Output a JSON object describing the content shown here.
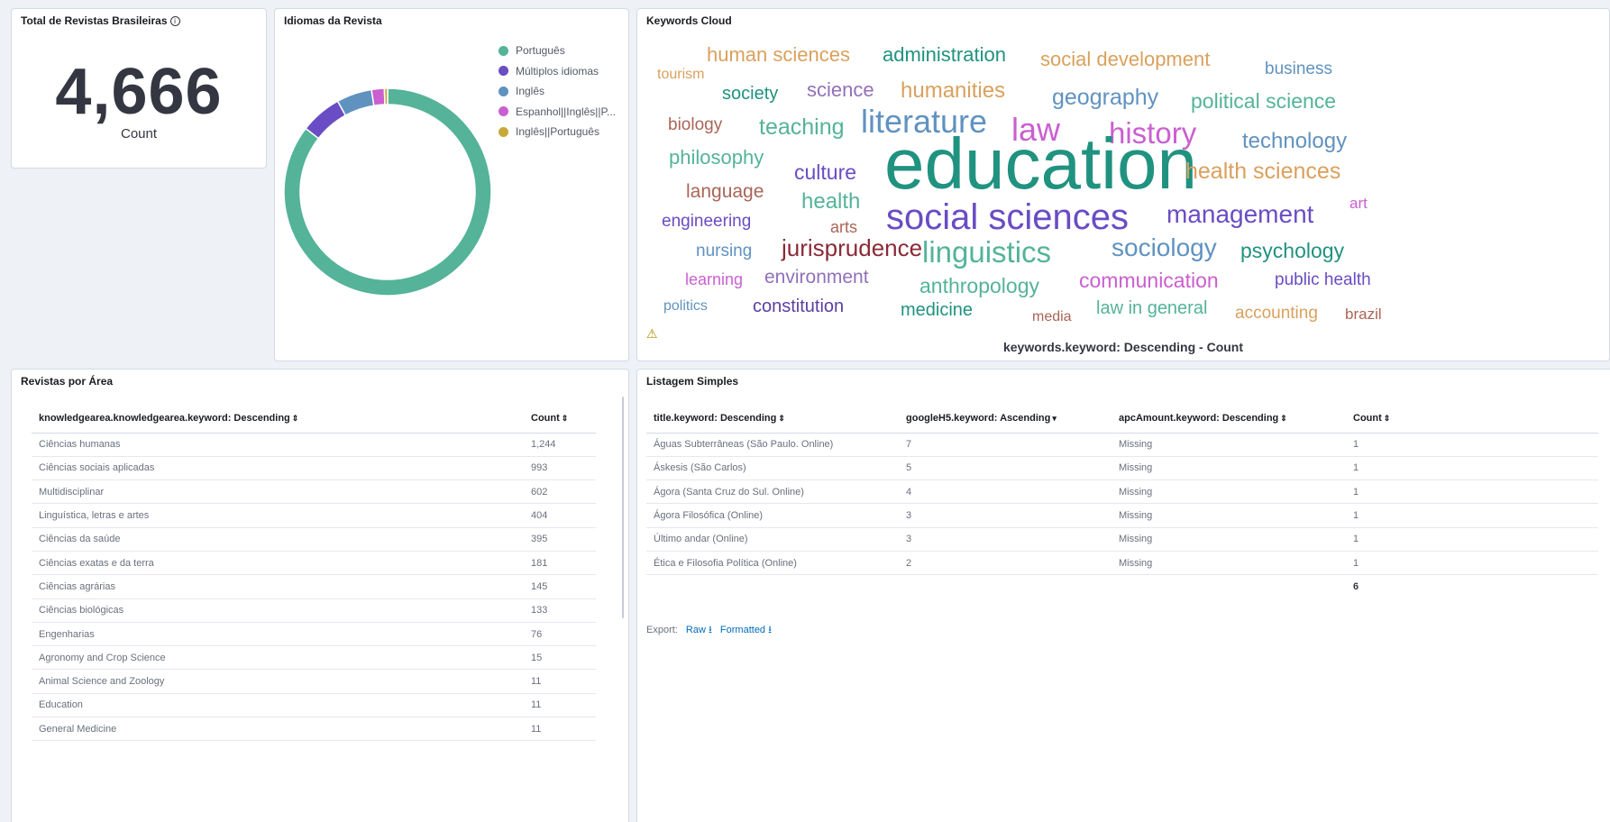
{
  "colors": {
    "green": "#54b399",
    "purple": "#6a4cc4",
    "blue": "#6092c0",
    "pink": "#d36086",
    "gold": "#d6bf57",
    "link": "#006bb8"
  },
  "metric_panel": {
    "title": "Total de Revistas Brasileiras",
    "info_icon": "info-circle-icon",
    "value": "4,666",
    "label": "Count"
  },
  "donut_panel": {
    "title": "Idiomas da Revista",
    "legend": [
      {
        "label": "Português",
        "color": "#54b399"
      },
      {
        "label": "Múltiplos idiomas",
        "color": "#6a4cc4"
      },
      {
        "label": "Inglês",
        "color": "#6092c0"
      },
      {
        "label": "Espanhol||Inglês||P...",
        "color": "#ca5fd0"
      },
      {
        "label": "Inglês||Português",
        "color": "#c7a93a"
      }
    ],
    "chart_data": {
      "type": "pie",
      "donut": true,
      "categories": [
        "Português",
        "Múltiplos idiomas",
        "Inglês",
        "Espanhol||Inglês||P...",
        "Inglês||Português"
      ],
      "values": [
        85.5,
        6.5,
        5.5,
        2.0,
        0.5
      ],
      "unit": "share (%)"
    }
  },
  "cloud_panel": {
    "title": "Keywords Cloud",
    "warning_icon": "warning-triangle-icon",
    "caption": "keywords.keyword: Descending - Count",
    "words": [
      {
        "text": "human sciences",
        "color": "#daa05d",
        "size": 22
      },
      {
        "text": "administration",
        "color": "#209280",
        "size": 22
      },
      {
        "text": "social development",
        "color": "#daa05d",
        "size": 22
      },
      {
        "text": "business",
        "color": "#6092c0",
        "size": 19
      },
      {
        "text": "tourism",
        "color": "#daa05d",
        "size": 16
      },
      {
        "text": "society",
        "color": "#209280",
        "size": 20
      },
      {
        "text": "science",
        "color": "#9170b8",
        "size": 22
      },
      {
        "text": "humanities",
        "color": "#daa05d",
        "size": 24
      },
      {
        "text": "geography",
        "color": "#6092c0",
        "size": 25
      },
      {
        "text": "political science",
        "color": "#54b399",
        "size": 23
      },
      {
        "text": "biology",
        "color": "#aa6556",
        "size": 19
      },
      {
        "text": "teaching",
        "color": "#54b399",
        "size": 25
      },
      {
        "text": "literature",
        "color": "#6092c0",
        "size": 36
      },
      {
        "text": "law",
        "color": "#ca5fd0",
        "size": 36
      },
      {
        "text": "history",
        "color": "#ca5fd0",
        "size": 33
      },
      {
        "text": "technology",
        "color": "#6092c0",
        "size": 24
      },
      {
        "text": "philosophy",
        "color": "#54b399",
        "size": 22
      },
      {
        "text": "culture",
        "color": "#6a4cc4",
        "size": 23
      },
      {
        "text": "education",
        "color": "#209280",
        "size": 80
      },
      {
        "text": "health sciences",
        "color": "#daa05d",
        "size": 25
      },
      {
        "text": "language",
        "color": "#aa6556",
        "size": 21
      },
      {
        "text": "health",
        "color": "#54b399",
        "size": 24
      },
      {
        "text": "art",
        "color": "#ca5fd0",
        "size": 17
      },
      {
        "text": "engineering",
        "color": "#6a4cc4",
        "size": 19
      },
      {
        "text": "arts",
        "color": "#aa6556",
        "size": 18
      },
      {
        "text": "social sciences",
        "color": "#6a4cc4",
        "size": 40
      },
      {
        "text": "management",
        "color": "#6a4cc4",
        "size": 28
      },
      {
        "text": "nursing",
        "color": "#6092c0",
        "size": 19
      },
      {
        "text": "jurisprudence",
        "color": "#8a2a36",
        "size": 26
      },
      {
        "text": "linguistics",
        "color": "#54b399",
        "size": 33
      },
      {
        "text": "sociology",
        "color": "#6092c0",
        "size": 28
      },
      {
        "text": "psychology",
        "color": "#209280",
        "size": 23
      },
      {
        "text": "learning",
        "color": "#ca5fd0",
        "size": 18
      },
      {
        "text": "environment",
        "color": "#9170b8",
        "size": 21
      },
      {
        "text": "anthropology",
        "color": "#54b399",
        "size": 23
      },
      {
        "text": "communication",
        "color": "#ca5fd0",
        "size": 23
      },
      {
        "text": "public health",
        "color": "#6a4cc4",
        "size": 19
      },
      {
        "text": "politics",
        "color": "#6092c0",
        "size": 16
      },
      {
        "text": "constitution",
        "color": "#5a3fa0",
        "size": 20
      },
      {
        "text": "medicine",
        "color": "#209280",
        "size": 20
      },
      {
        "text": "media",
        "color": "#aa6556",
        "size": 16
      },
      {
        "text": "law in general",
        "color": "#54b399",
        "size": 20
      },
      {
        "text": "accounting",
        "color": "#daa05d",
        "size": 19
      },
      {
        "text": "brazil",
        "color": "#aa6556",
        "size": 17
      }
    ]
  },
  "area_panel": {
    "title": "Revistas por Área",
    "columns": [
      "knowledgearea.knowledgearea.keyword: Descending",
      "Count"
    ],
    "sort_icon": "sort-icon",
    "rows": [
      [
        "Ciências humanas",
        "1,244"
      ],
      [
        "Ciências sociais aplicadas",
        "993"
      ],
      [
        "Multidisciplinar",
        "602"
      ],
      [
        "Linguística, letras e artes",
        "404"
      ],
      [
        "Ciências da saúde",
        "395"
      ],
      [
        "Ciências exatas e da terra",
        "181"
      ],
      [
        "Ciências agrárias",
        "145"
      ],
      [
        "Ciências biológicas",
        "133"
      ],
      [
        "Engenharias",
        "76"
      ],
      [
        "Agronomy and Crop Science",
        "15"
      ],
      [
        "Animal Science and Zoology",
        "11"
      ],
      [
        "Education",
        "11"
      ],
      [
        "General Medicine",
        "11"
      ]
    ]
  },
  "list_panel": {
    "title": "Listagem Simples",
    "columns": [
      "title.keyword: Descending",
      "googleH5.keyword: Ascending",
      "apcAmount.keyword: Descending",
      "Count"
    ],
    "rows": [
      [
        "Águas Subterrâneas (São Paulo. Online)",
        "7",
        "Missing",
        "1"
      ],
      [
        "Áskesis (São Carlos)",
        "5",
        "Missing",
        "1"
      ],
      [
        "Ágora (Santa Cruz do Sul. Online)",
        "4",
        "Missing",
        "1"
      ],
      [
        "Ágora Filosófica (Online)",
        "3",
        "Missing",
        "1"
      ],
      [
        "Último andar (Online)",
        "3",
        "Missing",
        "1"
      ],
      [
        "Ética e Filosofia Política (Online)",
        "2",
        "Missing",
        "1"
      ]
    ],
    "total": "6",
    "export_label": "Export:",
    "export_raw": "Raw",
    "export_formatted": "Formatted",
    "download_icon": "download-icon"
  }
}
